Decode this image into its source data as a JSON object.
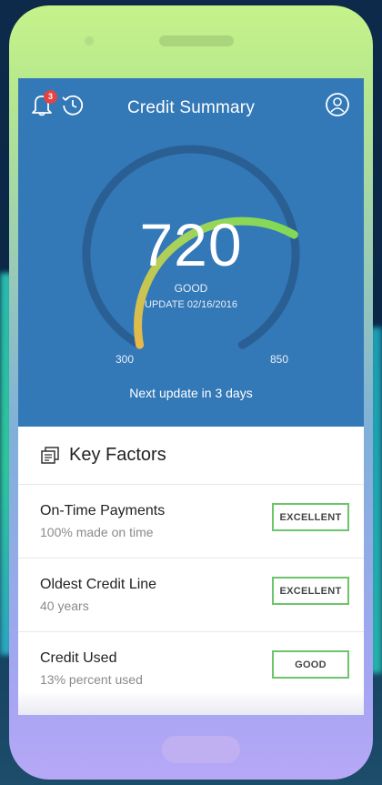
{
  "header": {
    "title": "Credit Summary",
    "notification_count": "3"
  },
  "score": {
    "value": "720",
    "rating": "GOOD",
    "updated": "UPDATE 02/16/2016",
    "min": "300",
    "max": "850",
    "next_update": "Next update in 3 days"
  },
  "key_factors": {
    "title": "Key Factors",
    "items": [
      {
        "label": "On-Time Payments",
        "detail": "100% made on time",
        "status": "EXCELLENT"
      },
      {
        "label": "Oldest Credit Line",
        "detail": "40 years",
        "status": "EXCELLENT"
      },
      {
        "label": "Credit Used",
        "detail": "13% percent used",
        "status": "GOOD"
      }
    ]
  },
  "icons": [
    "bell-icon",
    "history-icon",
    "profile-icon",
    "document-icon"
  ],
  "colors": {
    "summary_bg": "#3378b7",
    "gauge_low": "#e8b84a",
    "gauge_high": "#7ed957",
    "gauge_track": "#2a5f94",
    "status_border": "#6cc56a",
    "badge": "#e24444"
  }
}
